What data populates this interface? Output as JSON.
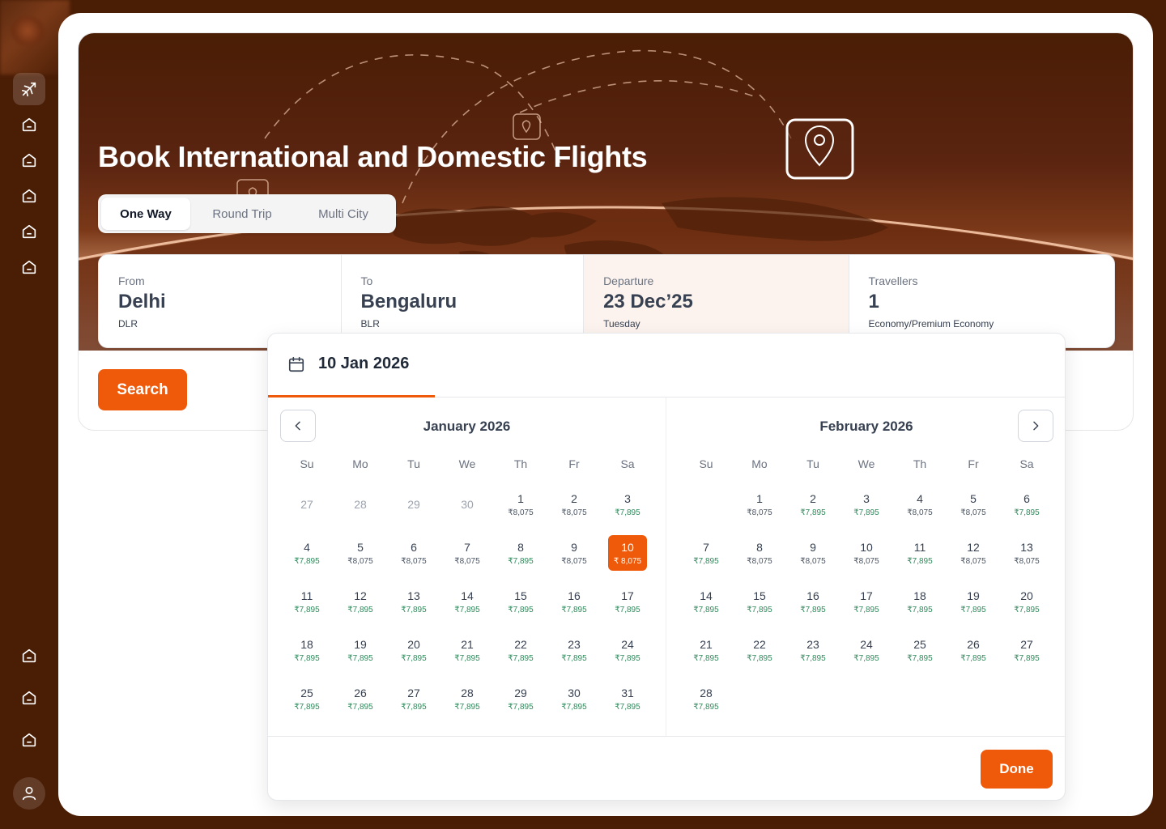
{
  "sidebar": {
    "items": [
      {
        "icon": "flight-icon",
        "active": true
      },
      {
        "icon": "home-icon"
      },
      {
        "icon": "home-icon"
      },
      {
        "icon": "home-icon"
      },
      {
        "icon": "home-icon"
      },
      {
        "icon": "home-icon"
      }
    ],
    "bottom_items": [
      {
        "icon": "home-icon"
      },
      {
        "icon": "home-icon"
      },
      {
        "icon": "home-icon"
      }
    ],
    "avatar_icon": "user-icon"
  },
  "hero": {
    "title": "Book International and Domestic Flights"
  },
  "trip_types": {
    "options": [
      "One Way",
      "Round Trip",
      "Multi City"
    ],
    "selected": "One Way"
  },
  "search_fields": {
    "from": {
      "label": "From",
      "value": "Delhi",
      "sub": "DLR"
    },
    "to": {
      "label": "To",
      "value": "Bengaluru",
      "sub": "BLR"
    },
    "departure": {
      "label": "Departure",
      "value": "23 Dec’25",
      "sub": "Tuesday"
    },
    "travellers": {
      "label": "Travellers",
      "value": "1",
      "sub": "Economy/Premium Economy"
    }
  },
  "search_button": "Search",
  "calendar": {
    "selected_label": "10 Jan 2026",
    "months": [
      {
        "title": "January 2026",
        "weekdays": [
          "Su",
          "Mo",
          "Tu",
          "We",
          "Th",
          "Fr",
          "Sa"
        ],
        "days": [
          {
            "d": "27",
            "muted": true
          },
          {
            "d": "28",
            "muted": true
          },
          {
            "d": "29",
            "muted": true
          },
          {
            "d": "30",
            "muted": true
          },
          {
            "d": "1",
            "p": "₹8,075",
            "hi": true
          },
          {
            "d": "2",
            "p": "₹8,075",
            "hi": true
          },
          {
            "d": "3",
            "p": "₹7,895"
          },
          {
            "d": "4",
            "p": "₹7,895"
          },
          {
            "d": "5",
            "p": "₹8,075",
            "hi": true
          },
          {
            "d": "6",
            "p": "₹8,075",
            "hi": true
          },
          {
            "d": "7",
            "p": "₹8,075",
            "hi": true
          },
          {
            "d": "8",
            "p": "₹7,895"
          },
          {
            "d": "9",
            "p": "₹8,075",
            "hi": true
          },
          {
            "d": "10",
            "p": "₹ 8,075",
            "selected": true
          },
          {
            "d": "11",
            "p": "₹7,895"
          },
          {
            "d": "12",
            "p": "₹7,895"
          },
          {
            "d": "13",
            "p": "₹7,895"
          },
          {
            "d": "14",
            "p": "₹7,895"
          },
          {
            "d": "15",
            "p": "₹7,895"
          },
          {
            "d": "16",
            "p": "₹7,895"
          },
          {
            "d": "17",
            "p": "₹7,895"
          },
          {
            "d": "18",
            "p": "₹7,895"
          },
          {
            "d": "19",
            "p": "₹7,895"
          },
          {
            "d": "20",
            "p": "₹7,895"
          },
          {
            "d": "21",
            "p": "₹7,895"
          },
          {
            "d": "22",
            "p": "₹7,895"
          },
          {
            "d": "23",
            "p": "₹7,895"
          },
          {
            "d": "24",
            "p": "₹7,895"
          },
          {
            "d": "25",
            "p": "₹7,895"
          },
          {
            "d": "26",
            "p": "₹7,895"
          },
          {
            "d": "27",
            "p": "₹7,895"
          },
          {
            "d": "28",
            "p": "₹7,895"
          },
          {
            "d": "29",
            "p": "₹7,895"
          },
          {
            "d": "30",
            "p": "₹7,895"
          },
          {
            "d": "31",
            "p": "₹7,895"
          }
        ]
      },
      {
        "title": "February 2026",
        "weekdays": [
          "Su",
          "Mo",
          "Tu",
          "We",
          "Th",
          "Fr",
          "Sa"
        ],
        "days": [
          {
            "d": ""
          },
          {
            "d": "1",
            "p": "₹8,075",
            "hi": true
          },
          {
            "d": "2",
            "p": "₹7,895"
          },
          {
            "d": "3",
            "p": "₹7,895"
          },
          {
            "d": "4",
            "p": "₹8,075",
            "hi": true
          },
          {
            "d": "5",
            "p": "₹8,075",
            "hi": true
          },
          {
            "d": "6",
            "p": "₹7,895"
          },
          {
            "d": "7",
            "p": "₹7,895"
          },
          {
            "d": "8",
            "p": "₹8,075",
            "hi": true
          },
          {
            "d": "9",
            "p": "₹8,075",
            "hi": true
          },
          {
            "d": "10",
            "p": "₹8,075",
            "hi": true
          },
          {
            "d": "11",
            "p": "₹7,895"
          },
          {
            "d": "12",
            "p": "₹8,075",
            "hi": true
          },
          {
            "d": "13",
            "p": "₹8,075",
            "hi": true
          },
          {
            "d": "14",
            "p": "₹7,895"
          },
          {
            "d": "15",
            "p": "₹7,895"
          },
          {
            "d": "16",
            "p": "₹7,895"
          },
          {
            "d": "17",
            "p": "₹7,895"
          },
          {
            "d": "18",
            "p": "₹7,895"
          },
          {
            "d": "19",
            "p": "₹7,895"
          },
          {
            "d": "20",
            "p": "₹7,895"
          },
          {
            "d": "21",
            "p": "₹7,895"
          },
          {
            "d": "22",
            "p": "₹7,895"
          },
          {
            "d": "23",
            "p": "₹7,895"
          },
          {
            "d": "24",
            "p": "₹7,895"
          },
          {
            "d": "25",
            "p": "₹7,895"
          },
          {
            "d": "26",
            "p": "₹7,895"
          },
          {
            "d": "27",
            "p": "₹7,895"
          },
          {
            "d": "28",
            "p": "₹7,895"
          }
        ]
      }
    ],
    "prev_icon": "chevron-left-icon",
    "next_icon": "chevron-right-icon",
    "done_label": "Done"
  },
  "colors": {
    "brand": "#4a1d05",
    "accent": "#ef5a0a",
    "price_green": "#2f8a5b"
  }
}
